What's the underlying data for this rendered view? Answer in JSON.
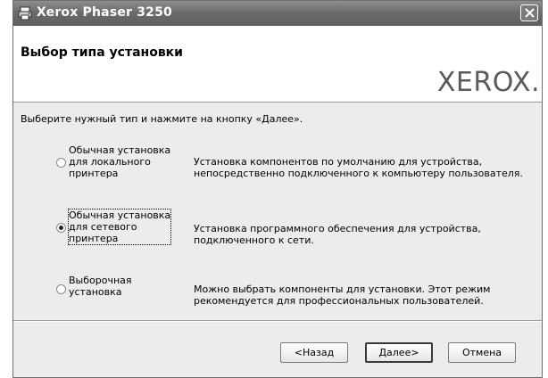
{
  "window": {
    "title": "Xerox Phaser 3250",
    "title_icon": "printer-icon",
    "close_icon": "close-icon"
  },
  "header": {
    "title": "Выбор типа установки",
    "logo": "XEROX."
  },
  "instruction": "Выберите нужный тип и нажмите на кнопку «Далее».",
  "options": [
    {
      "label": "Обычная установка\nдля локального\nпринтера",
      "description": "Установка компонентов по умолчанию для устройства,\nнепосредственно подключенного к компьютеру пользователя.",
      "selected": false
    },
    {
      "label": "Обычная установка\nдля сетевого\nпринтера",
      "description": "Установка программного обеспечения для устройства,\nподключенного к сети.",
      "selected": true
    },
    {
      "label": "Выборочная\nустановка",
      "description": "Можно выбрать компоненты для установки. Этот режим\nрекомендуется для профессиональных пользователей.",
      "selected": false
    }
  ],
  "buttons": {
    "back": "<Назад",
    "next": "Далее>",
    "cancel": "Отмена"
  }
}
